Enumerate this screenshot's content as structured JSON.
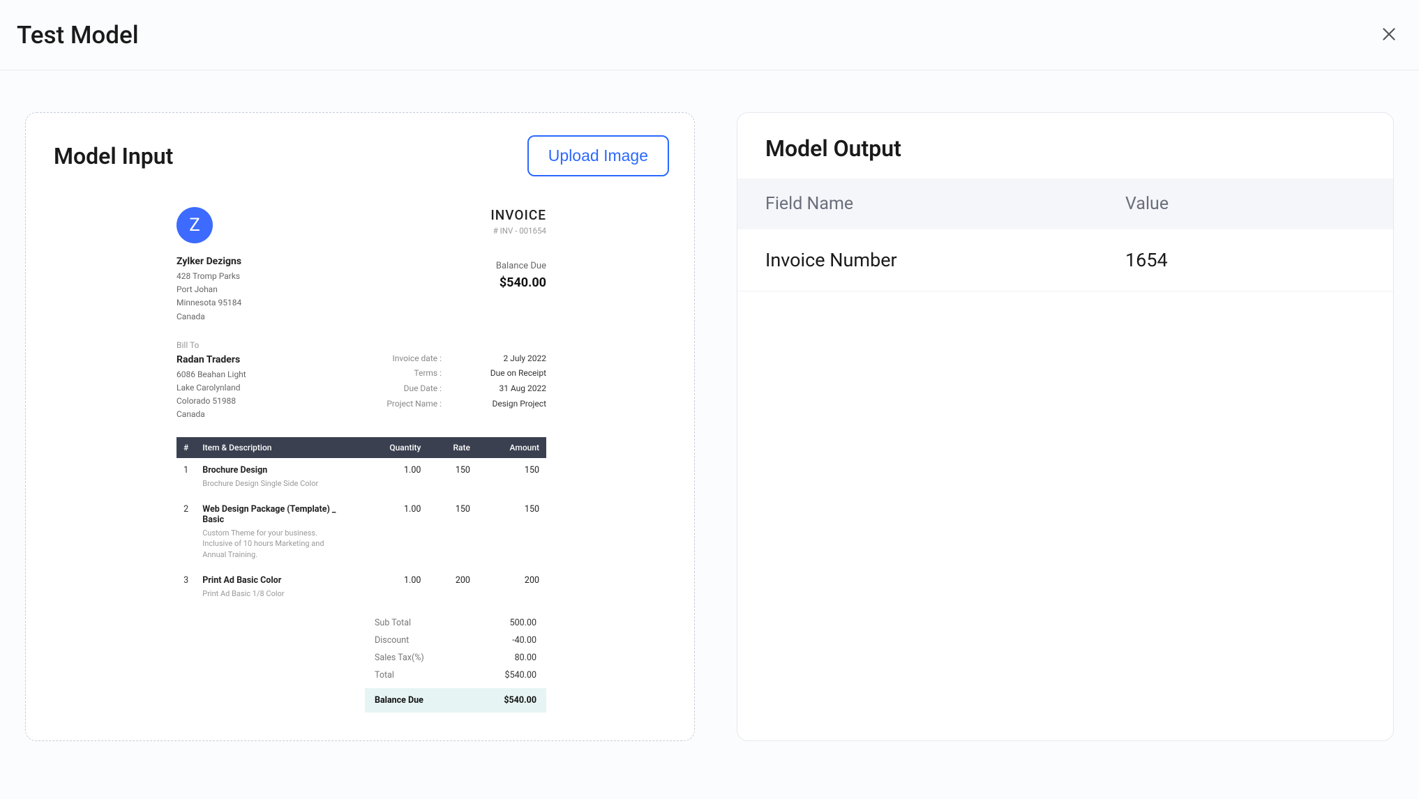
{
  "header": {
    "title": "Test Model"
  },
  "left": {
    "title": "Model Input",
    "upload_label": "Upload Image"
  },
  "invoice": {
    "logo_letter": "Z",
    "company": "Zylker Dezigns",
    "addr1": "428 Tromp Parks",
    "addr2": "Port Johan",
    "addr3": "Minnesota 95184",
    "addr4": "Canada",
    "title": "INVOICE",
    "number_label": "# INV - 001654",
    "balance_due_label": "Balance Due",
    "balance_due_amount": "$540.00",
    "billto_label": "Bill To",
    "billto_name": "Radan Traders",
    "billto_addr1": "6086 Beahan Light",
    "billto_addr2": "Lake Carolynland",
    "billto_addr3": "Colorado 51988",
    "billto_addr4": "Canada",
    "meta": [
      {
        "label": "Invoice date :",
        "value": "2 July 2022"
      },
      {
        "label": "Terms :",
        "value": "Due on Receipt"
      },
      {
        "label": "Due Date :",
        "value": "31 Aug 2022"
      },
      {
        "label": "Project Name :",
        "value": "Design Project"
      }
    ],
    "columns": {
      "idx": "#",
      "desc": "Item  & Description",
      "qty": "Quantity",
      "rate": "Rate",
      "amount": "Amount"
    },
    "items": [
      {
        "idx": "1",
        "name": "Brochure Design",
        "note": "Brochure Design Single Side Color",
        "qty": "1.00",
        "rate": "150",
        "amount": "150"
      },
      {
        "idx": "2",
        "name": "Web Design Package (Template) _ Basic",
        "note": "Custom Theme for your business. Inclusive of 10 hours Marketing and Annual Training.",
        "qty": "1.00",
        "rate": "150",
        "amount": "150"
      },
      {
        "idx": "3",
        "name": "Print Ad Basic Color",
        "note": "Print Ad Basic 1/8 Color",
        "qty": "1.00",
        "rate": "200",
        "amount": "200"
      }
    ],
    "totals": [
      {
        "label": "Sub Total",
        "value": "500.00"
      },
      {
        "label": "Discount",
        "value": "-40.00"
      },
      {
        "label": "Sales Tax(%)",
        "value": "80.00"
      },
      {
        "label": "Total",
        "value": "$540.00"
      }
    ],
    "final_balance_label": "Balance Due",
    "final_balance_value": "$540.00"
  },
  "right": {
    "title": "Model Output",
    "col_field": "Field Name",
    "col_value": "Value",
    "rows": [
      {
        "field": "Invoice Number",
        "value": "1654"
      }
    ]
  }
}
